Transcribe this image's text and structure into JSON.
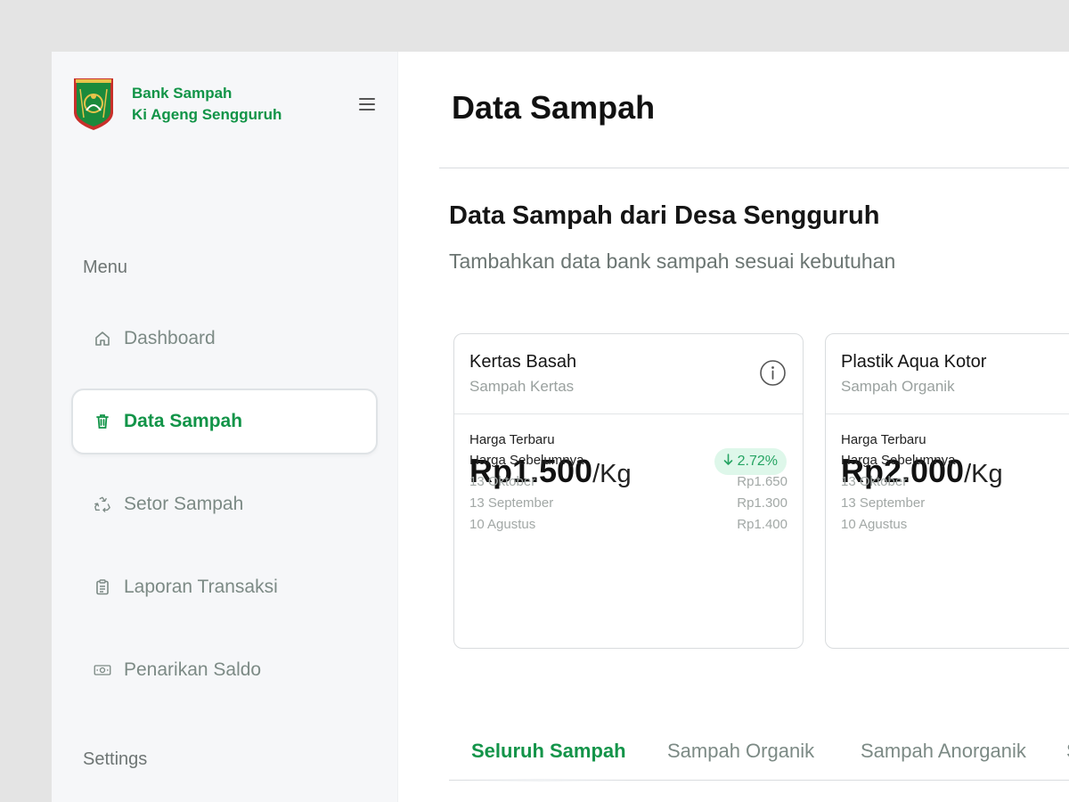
{
  "brand": {
    "line1": "Bank Sampah",
    "line2": "Ki Ageng Sengguruh"
  },
  "sidebar": {
    "menu_title": "Menu",
    "items": [
      {
        "label": "Dashboard",
        "icon": "home-icon"
      },
      {
        "label": "Data Sampah",
        "icon": "trash-icon",
        "active": true
      },
      {
        "label": "Setor Sampah",
        "icon": "recycle-icon"
      },
      {
        "label": "Laporan Transaksi",
        "icon": "clipboard-icon"
      },
      {
        "label": "Penarikan Saldo",
        "icon": "cash-icon"
      }
    ],
    "settings_title": "Settings"
  },
  "header": {
    "title": "Data Sampah"
  },
  "section": {
    "heading": "Data Sampah dari Desa Sengguruh",
    "subtitle": "Tambahkan data bank sampah sesuai kebutuhan"
  },
  "cards": [
    {
      "name": "Kertas Basah",
      "category": "Sampah Kertas",
      "latest_label": "Harga Terbaru",
      "price": "Rp1.500",
      "unit": "/Kg",
      "change": "2.72%",
      "change_direction": "down",
      "previous_label": "Harga Sebelumnya",
      "history": [
        {
          "date": "13 Oktober",
          "price": "Rp1.650"
        },
        {
          "date": "13 September",
          "price": "Rp1.300"
        },
        {
          "date": "10 Agustus",
          "price": "Rp1.400"
        }
      ]
    },
    {
      "name": "Plastik Aqua Kotor",
      "category": "Sampah Organik",
      "latest_label": "Harga Terbaru",
      "price": "Rp2.000",
      "unit": "/Kg",
      "previous_label": "Harga Sebelumnya",
      "history": [
        {
          "date": "13 Oktober"
        },
        {
          "date": "13 September"
        },
        {
          "date": "10 Agustus"
        }
      ]
    }
  ],
  "tabs": [
    {
      "label": "Seluruh Sampah",
      "active": true
    },
    {
      "label": "Sampah Organik"
    },
    {
      "label": "Sampah Anorganik"
    },
    {
      "label": "S"
    }
  ],
  "colors": {
    "accent": "#129448",
    "badge_bg": "#def7ea",
    "badge_text": "#26a463",
    "muted": "#7c8a85"
  }
}
